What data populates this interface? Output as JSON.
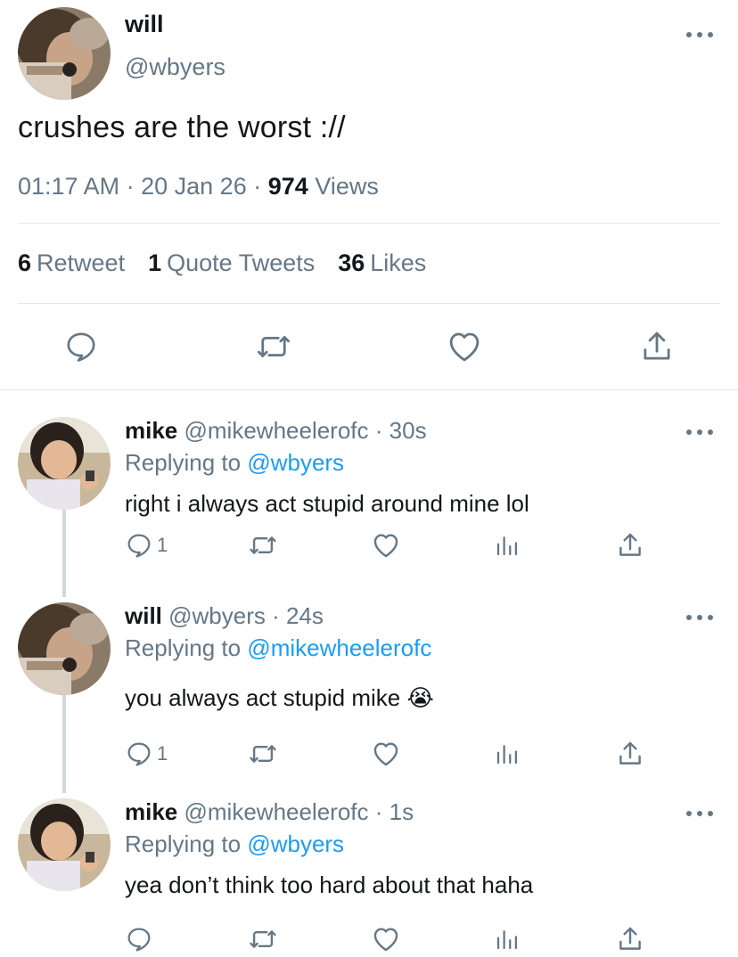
{
  "tweet": {
    "name": "will",
    "handle": "@wbyers",
    "text": "crushes are the worst ://",
    "time": "01:17 AM",
    "sep1": "·",
    "date": "20 Jan 26",
    "sep2": "·",
    "views_count": "974",
    "views_label": "Views",
    "retweets_count": "6",
    "retweets_label": "Retweet",
    "quotes_count": "1",
    "quotes_label": "Quote Tweets",
    "likes_count": "36",
    "likes_label": "Likes"
  },
  "replies": [
    {
      "name": "mike",
      "handle": "@mikewheelerofc",
      "age": "· 30s",
      "replying_label": "Replying to",
      "replying_to": "@wbyers",
      "text": "right i always act stupid around mine lol",
      "reply_count": "1"
    },
    {
      "name": "will",
      "handle": "@wbyers",
      "age": "· 24s",
      "replying_label": "Replying to",
      "replying_to": "@mikewheelerofc",
      "text": "you always act stupid mike",
      "emoji": "😭",
      "reply_count": "1"
    },
    {
      "name": "mike",
      "handle": "@mikewheelerofc",
      "age": "· 1s",
      "replying_label": "Replying to",
      "replying_to": "@wbyers",
      "text": "yea don’t think too hard about that haha",
      "reply_count": ""
    }
  ],
  "icons": {
    "reply": "reply-icon",
    "retweet": "retweet-icon",
    "like": "heart-icon",
    "share": "share-icon",
    "analytics": "analytics-icon",
    "more": "more-icon"
  },
  "colors": {
    "accent": "#1d9bf0",
    "secondary_text": "#657786",
    "divider": "#e1e8ed"
  }
}
